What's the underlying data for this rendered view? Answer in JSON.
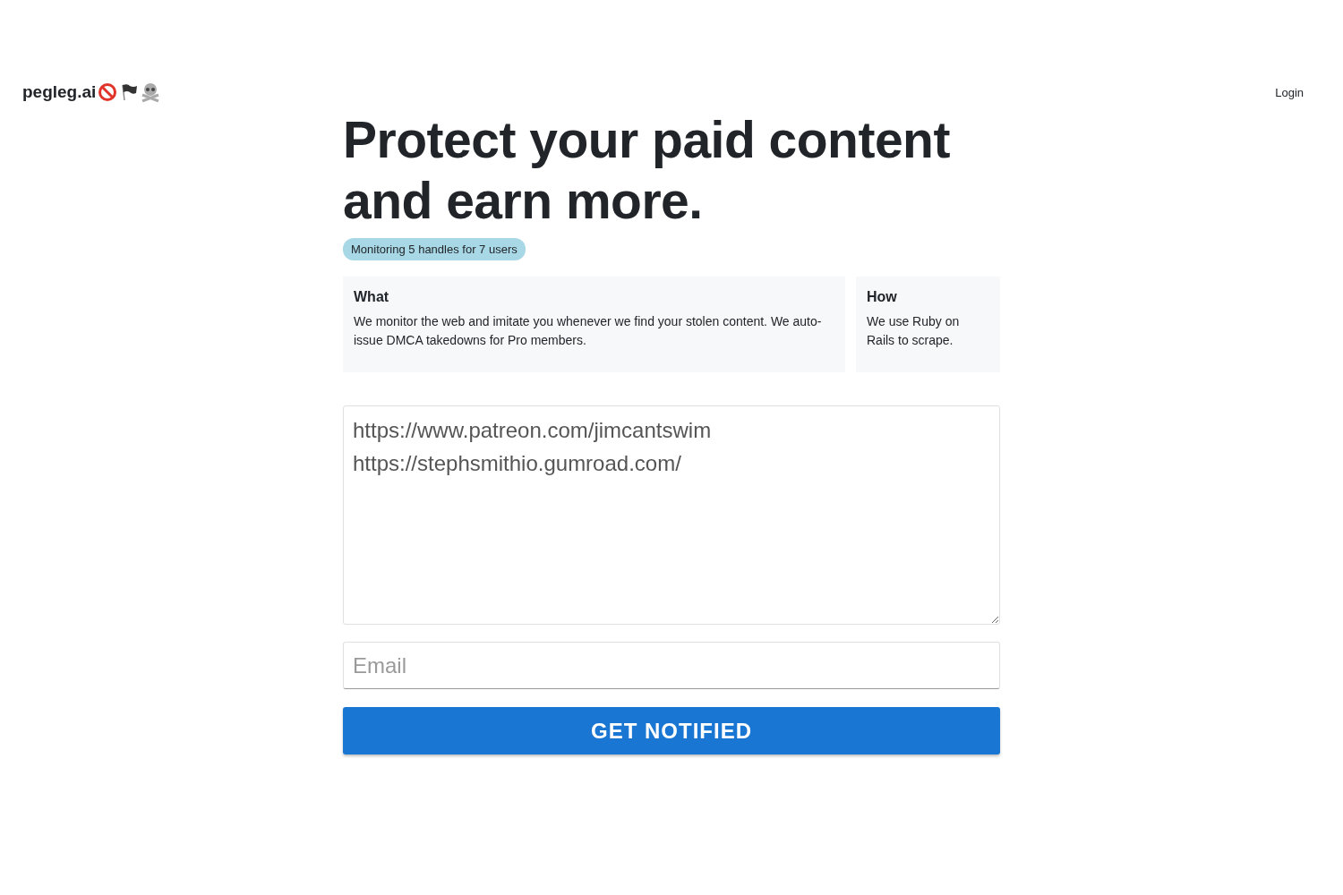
{
  "header": {
    "logo": "pegleg.ai",
    "login": "Login"
  },
  "headline": "Protect your paid content and earn more.",
  "badge": "Monitoring 5 handles for 7 users",
  "cards": [
    {
      "title": "What",
      "text": "We monitor the web and imitate you whenever we find your stolen content. We auto-issue DMCA takedowns for Pro members."
    },
    {
      "title": "How",
      "text": "We use Ruby on Rails to scrape."
    }
  ],
  "urls": {
    "lines": [
      "https://www.patreon.com/jimcantswim",
      "https://stephsmithio.gumroad.com/"
    ]
  },
  "email": {
    "placeholder": "Email"
  },
  "submit": "GET NOTIFIED"
}
